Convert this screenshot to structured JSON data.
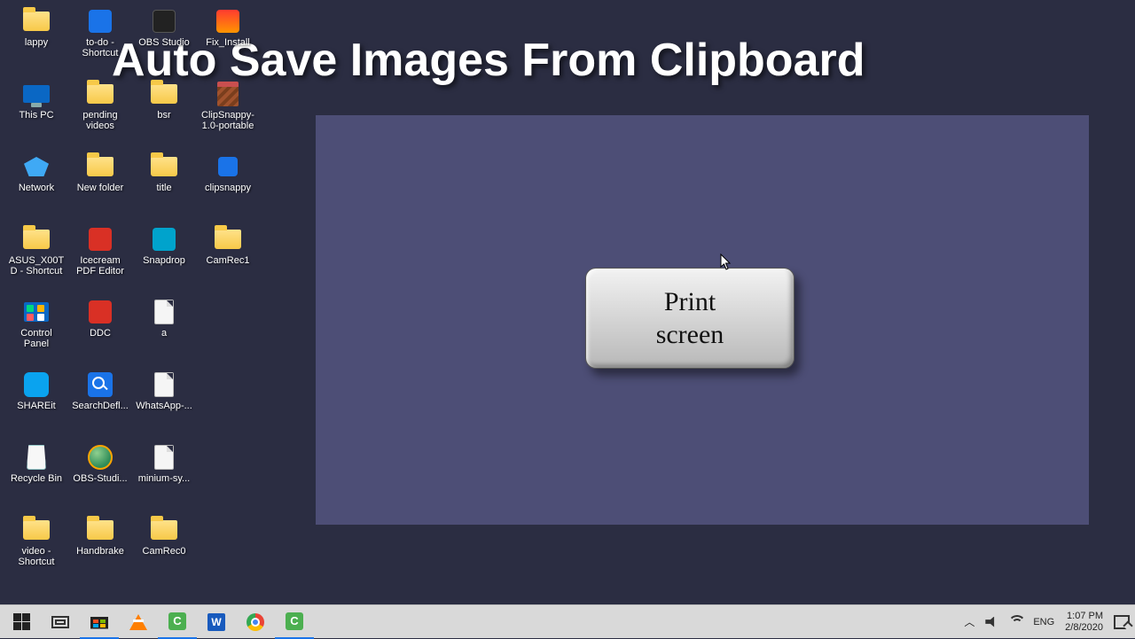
{
  "headline": "Auto Save Images From Clipboard",
  "desktop_icons": [
    {
      "label": "lappy",
      "type": "folder"
    },
    {
      "label": "to-do - Shortcut",
      "type": "blue"
    },
    {
      "label": "OBS Studio",
      "type": "dark"
    },
    {
      "label": "Fix_Install",
      "type": "orange"
    },
    {
      "label": "This PC",
      "type": "pc"
    },
    {
      "label": "pending videos",
      "type": "folder"
    },
    {
      "label": "bsr",
      "type": "folder"
    },
    {
      "label": "ClipSnappy-1.0-portable",
      "type": "rar"
    },
    {
      "label": "Network",
      "type": "net"
    },
    {
      "label": "New folder",
      "type": "folder"
    },
    {
      "label": "title",
      "type": "folder"
    },
    {
      "label": "clipsnappy",
      "type": "exe-blue"
    },
    {
      "label": "ASUS_X00TD - Shortcut",
      "type": "folder"
    },
    {
      "label": "Icecream PDF Editor",
      "type": "red"
    },
    {
      "label": "Snapdrop",
      "type": "teal"
    },
    {
      "label": "CamRec1",
      "type": "folder"
    },
    {
      "label": "Control Panel",
      "type": "cp"
    },
    {
      "label": "DDC",
      "type": "red"
    },
    {
      "label": "a",
      "type": "file"
    },
    {
      "label": "",
      "type": "empty"
    },
    {
      "label": "SHAREit",
      "type": "share"
    },
    {
      "label": "SearchDefl...",
      "type": "search"
    },
    {
      "label": "WhatsApp-...",
      "type": "file"
    },
    {
      "label": "",
      "type": "empty"
    },
    {
      "label": "Recycle Bin",
      "type": "bin"
    },
    {
      "label": "OBS-Studi...",
      "type": "globe"
    },
    {
      "label": "minium-sy...",
      "type": "file"
    },
    {
      "label": "",
      "type": "empty"
    },
    {
      "label": "video - Shortcut",
      "type": "folder"
    },
    {
      "label": "Handbrake",
      "type": "folder"
    },
    {
      "label": "CamRec0",
      "type": "folder"
    },
    {
      "label": "",
      "type": "empty"
    }
  ],
  "print_key": {
    "line1": "Print",
    "line2": "screen"
  },
  "taskbar": {
    "items": [
      "start",
      "taskview",
      "store",
      "vlc",
      "camtasia",
      "word",
      "chrome",
      "camtasia2"
    ]
  },
  "tray": {
    "lang": "ENG",
    "time": "1:07 PM",
    "date": "2/8/2020"
  }
}
